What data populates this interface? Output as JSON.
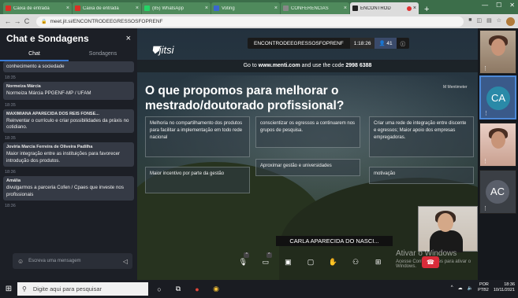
{
  "browser": {
    "tabs": [
      {
        "title": "Caixa de entrada",
        "favcolor": "#d93025",
        "active": false
      },
      {
        "title": "Caixa de entrada",
        "favcolor": "#d93025",
        "active": false
      },
      {
        "title": "(85) WhatsApp",
        "favcolor": "#25d366",
        "active": false
      },
      {
        "title": "Voting",
        "favcolor": "#3a66d0",
        "active": false
      },
      {
        "title": "CONFERENCIAS",
        "favcolor": "#888888",
        "active": false
      },
      {
        "title": "ENCONTROD",
        "favcolor": "#222222",
        "active": true
      }
    ],
    "newtab": "+",
    "url": "meet.jit.si/ENCONTRODEEGRESSOSFOPRENF"
  },
  "chat": {
    "title": "Chat e Sondagens",
    "close": "×",
    "tabs": [
      "Chat",
      "Sondagens"
    ],
    "messages": [
      {
        "who": "",
        "text": "conhecimento a sociedade",
        "ts": "18:35"
      },
      {
        "who": "Normeiza Márcia",
        "text": "Normeiza Márcia PPGENF-MP / UFAM",
        "ts": "18:35"
      },
      {
        "who": "MAXIMIANA APARECIDA DOS REIS FONSE...",
        "text": "Reinventar o currículo e criar possibilidades da práxis no cotidiano.",
        "ts": "18:35"
      },
      {
        "who": "Jovíria Marcia Ferreira de Oliveira Padilha",
        "text": "Maior integração entre as instituições para favorecer introdução dos produtos.",
        "ts": "18:36"
      },
      {
        "who": "Amália",
        "text": "divulgarmos a parceria Cofen / Cpaes que investe nos profissionais",
        "ts": "18:36"
      }
    ],
    "input_placeholder": "Escreva uma mensagem"
  },
  "stage": {
    "brand": "jitsi",
    "meeting_name": "ENCONTRODEEGRESSOSFOPRENF",
    "time": "1:18:26",
    "participants": "41",
    "info": "ⓘ",
    "menti_prefix": "Go to ",
    "menti_url": "www.menti.com",
    "menti_mid": " and use the code ",
    "menti_code": "2998 6388",
    "question": "O que propomos para melhorar o mestrado/doutorado profissional?",
    "mentimeter": "M Mentimeter",
    "answers": [
      "Melhoria no compartilhamento dos produtos para facilitar a implementação em todo rede nacional",
      "conscientizar os egressos a continuarem nos grupos de pesquisa.",
      "Criar uma rede de integração entre discente e egressos; Maior apoio dos empresas empregadoras.",
      "Maior incentivo por parte da gestão",
      "Aproximar gestão e universidades",
      "motivação"
    ],
    "speaker": "CARLA APARECIDA DO NASCI...",
    "watermark_title": "Ativar o Windows",
    "watermark_sub": "Acesse Configurações para ativar o Windows."
  },
  "filmstrip": {
    "initials": [
      "CA",
      "AC"
    ],
    "dots": "⋮"
  },
  "taskbar": {
    "search_placeholder": "Digite aqui para pesquisar",
    "lang": "POR",
    "region": "PTB2",
    "time": "18:36",
    "date": "10/11/2021"
  }
}
